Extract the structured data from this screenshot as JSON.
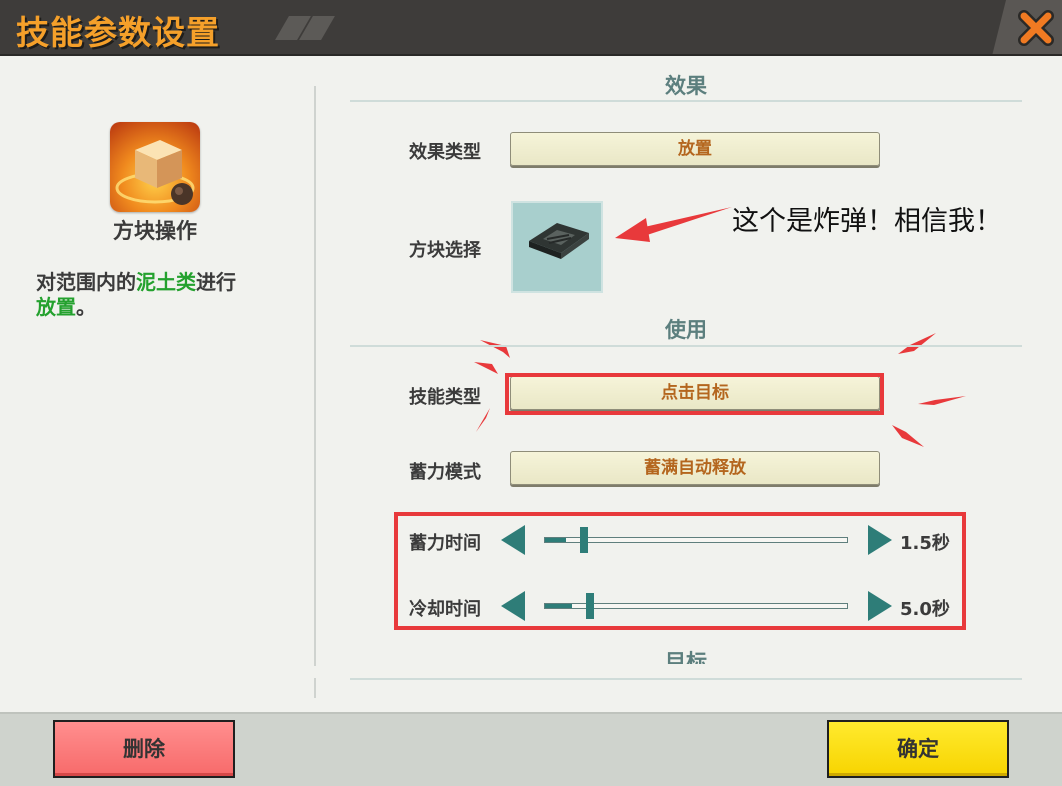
{
  "window": {
    "title": "技能参数设置"
  },
  "skill": {
    "name": "方块操作",
    "description": {
      "prefix": "对范围内的",
      "highlight1": "泥土类",
      "middle": "进行",
      "highlight2": "放置",
      "suffix": "。"
    }
  },
  "sections": {
    "effect": {
      "title": "效果",
      "effect_type_label": "效果类型",
      "effect_type_value": "放置",
      "block_select_label": "方块选择"
    },
    "use": {
      "title": "使用",
      "skill_type_label": "技能类型",
      "skill_type_value": "点击目标",
      "charge_mode_label": "蓄力模式",
      "charge_mode_value": "蓄满自动释放"
    },
    "target": {
      "title": "目标"
    }
  },
  "sliders": {
    "charge_time": {
      "label": "蓄力时间",
      "value_text": "1.5秒",
      "level": 0.07
    },
    "cooldown_time": {
      "label": "冷却时间",
      "value_text": "5.0秒",
      "level": 0.09
    }
  },
  "annotation": {
    "callout": "这个是炸弹！相信我！"
  },
  "footer": {
    "delete_label": "删除",
    "confirm_label": "确定"
  },
  "colors": {
    "accent_title": "#f5a02a",
    "annotation_red": "#e8393b",
    "slider": "#2e7d78",
    "highlight_green": "#24a12e"
  },
  "icons": [
    "close-icon",
    "block-operation-icon",
    "bomb-block-icon",
    "slider-left-arrow-icon",
    "slider-right-arrow-icon"
  ]
}
